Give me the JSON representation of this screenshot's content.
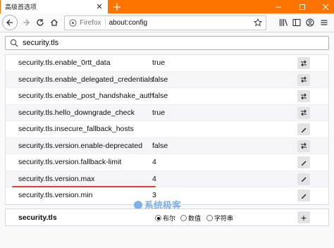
{
  "tab": {
    "title": "高级首选项"
  },
  "urlbar": {
    "brand": "Firefox",
    "url": "about:config"
  },
  "search": {
    "value": "security.tls"
  },
  "prefs": [
    {
      "name": "security.tls.enable_0rtt_data",
      "value": "true",
      "action": "toggle"
    },
    {
      "name": "security.tls.enable_delegated_credentials",
      "value": "false",
      "action": "toggle"
    },
    {
      "name": "security.tls.enable_post_handshake_auth",
      "value": "false",
      "action": "toggle"
    },
    {
      "name": "security.tls.hello_downgrade_check",
      "value": "true",
      "action": "toggle"
    },
    {
      "name": "security.tls.insecure_fallback_hosts",
      "value": "",
      "action": "edit"
    },
    {
      "name": "security.tls.version.enable-deprecated",
      "value": "false",
      "action": "toggle"
    },
    {
      "name": "security.tls.version.fallback-limit",
      "value": "4",
      "action": "edit"
    },
    {
      "name": "security.tls.version.max",
      "value": "4",
      "action": "edit"
    },
    {
      "name": "security.tls.version.min",
      "value": "3",
      "action": "edit"
    }
  ],
  "add_row": {
    "name": "security.tls",
    "types": [
      {
        "label": "布尔",
        "selected": true
      },
      {
        "label": "数值",
        "selected": false
      },
      {
        "label": "字符串",
        "selected": false
      }
    ],
    "add_label": "+"
  },
  "watermark": {
    "text": "系统极客"
  },
  "colors": {
    "tabbar": "#ff7300",
    "highlight_underline": "#e63c3c",
    "watermark": "#6fa9e6"
  }
}
